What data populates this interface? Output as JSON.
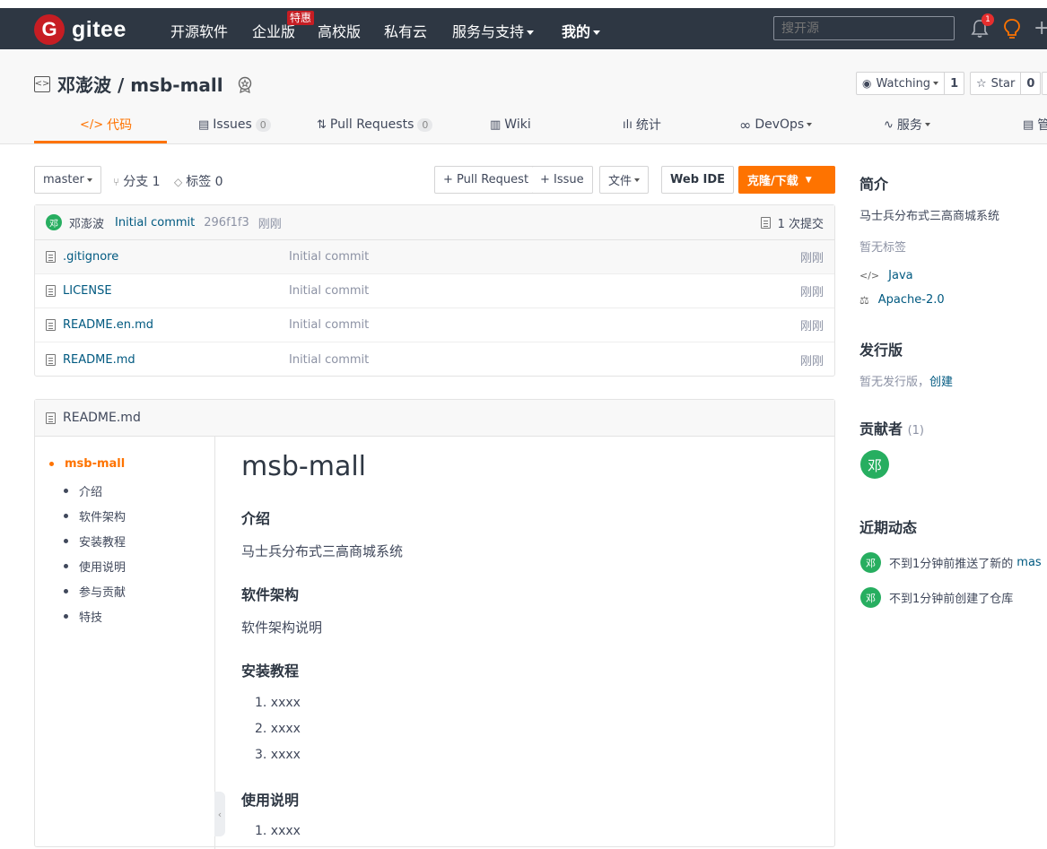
{
  "nav": {
    "logo_letter": "G",
    "logo_text": "gitee",
    "items": [
      "开源软件",
      "企业版",
      "高校版",
      "私有云",
      "服务与支持",
      "我的"
    ],
    "special_badge": "特惠",
    "search_placeholder": "搜开源",
    "notification_count": "1"
  },
  "repo": {
    "title": "邓澎波 / msb-mall",
    "watch_label": "Watching",
    "watch_count": "1",
    "star_label": "Star",
    "star_count": "0"
  },
  "tabs": [
    {
      "label": "代码"
    },
    {
      "label": "Issues",
      "count": "0"
    },
    {
      "label": "Pull Requests",
      "count": "0"
    },
    {
      "label": "Wiki"
    },
    {
      "label": "统计"
    },
    {
      "label": "DevOps"
    },
    {
      "label": "服务"
    },
    {
      "label": "管"
    }
  ],
  "toolbar": {
    "branch": "master",
    "branches": "分支 1",
    "tags": "标签 0",
    "pull_request": "+ Pull Request",
    "issue": "+ Issue",
    "file": "文件",
    "web_ide": "Web IDE",
    "clone": "克隆/下载"
  },
  "commit": {
    "avatar": "邓",
    "author": "邓澎波",
    "message": "Initial commit",
    "hash": "296f1f3",
    "time": "刚刚",
    "total": "1 次提交"
  },
  "files": [
    {
      "name": ".gitignore",
      "message": "Initial commit",
      "time": "刚刚"
    },
    {
      "name": "LICENSE",
      "message": "Initial commit",
      "time": "刚刚"
    },
    {
      "name": "README.en.md",
      "message": "Initial commit",
      "time": "刚刚"
    },
    {
      "name": "README.md",
      "message": "Initial commit",
      "time": "刚刚"
    }
  ],
  "readme": {
    "filename": "README.md",
    "toc": [
      "msb-mall",
      "介绍",
      "软件架构",
      "安装教程",
      "使用说明",
      "参与贡献",
      "特技"
    ],
    "h1": "msb-mall",
    "intro_h": "介绍",
    "intro_p": "马士兵分布式三高商城系统",
    "arch_h": "软件架构",
    "arch_p": "软件架构说明",
    "install_h": "安装教程",
    "install_items": [
      "1. xxxx",
      "2. xxxx",
      "3. xxxx"
    ],
    "usage_h": "使用说明",
    "usage_items": [
      "1. xxxx"
    ]
  },
  "sidebar": {
    "intro_h": "简介",
    "intro_text": "马士兵分布式三高商城系统",
    "no_tags": "暂无标签",
    "language": "Java",
    "license": "Apache-2.0",
    "release_h": "发行版",
    "no_release": "暂无发行版，",
    "create": "创建",
    "contrib_h": "贡献者",
    "contrib_count": "(1)",
    "contrib_avatar": "邓",
    "activity_h": "近期动态",
    "activities": [
      {
        "avatar": "邓",
        "text": "不到1分钟前推送了新的",
        "link": "mas"
      },
      {
        "avatar": "邓",
        "text": "不到1分钟前创建了仓库",
        "link": ""
      }
    ]
  },
  "colors": {
    "accent": "#fe7300",
    "nav_bg": "#2e3743",
    "brand": "#c71d23",
    "link": "#005980"
  }
}
